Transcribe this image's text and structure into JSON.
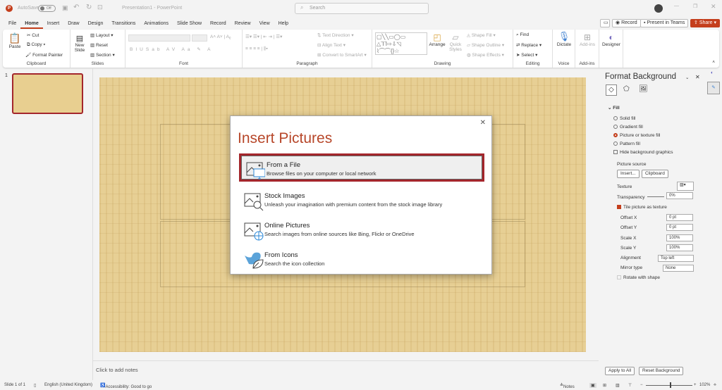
{
  "titlebar": {
    "autosave_label": "AutoSave",
    "autosave_state": "Off",
    "doc_title": "Presentation1 - PowerPoint",
    "search_placeholder": "Search"
  },
  "menu_tabs": [
    "File",
    "Home",
    "Insert",
    "Draw",
    "Design",
    "Transitions",
    "Animations",
    "Slide Show",
    "Record",
    "Review",
    "View",
    "Help"
  ],
  "active_tab": "Home",
  "top_buttons": {
    "record": "Record",
    "present_teams": "Present in Teams",
    "share": "Share"
  },
  "ribbon": {
    "clipboard": {
      "paste": "Paste",
      "cut": "Cut",
      "copy": "Copy",
      "format_painter": "Format Painter",
      "label": "Clipboard"
    },
    "slides": {
      "new_slide": "New Slide",
      "layout": "Layout",
      "reset": "Reset",
      "section": "Section",
      "label": "Slides"
    },
    "font": {
      "label": "Font",
      "bold": "B",
      "italic": "I",
      "underline": "U",
      "strike": "S"
    },
    "paragraph": {
      "text_direction": "Text Direction",
      "align_text": "Align Text",
      "convert_smartart": "Convert to SmartArt",
      "label": "Paragraph"
    },
    "drawing": {
      "arrange": "Arrange",
      "quick_styles": "Quick Styles",
      "shape_fill": "Shape Fill",
      "shape_outline": "Shape Outline",
      "shape_effects": "Shape Effects",
      "label": "Drawing"
    },
    "editing": {
      "find": "Find",
      "replace": "Replace",
      "select": "Select",
      "label": "Editing"
    },
    "voice": {
      "dictate": "Dictate",
      "label": "Voice"
    },
    "addins": {
      "addins": "Add-ins",
      "label": "Add-ins"
    },
    "designer": {
      "designer": "Designer"
    }
  },
  "thumbnail": {
    "number": "1"
  },
  "notes_placeholder": "Click to add notes",
  "dialog": {
    "title": "Insert Pictures",
    "options": [
      {
        "title": "From a File",
        "desc": "Browse files on your computer or local network",
        "icon": "picture-monitor-icon"
      },
      {
        "title": "Stock Images",
        "desc": "Unleash your imagination with premium content from the stock image library",
        "icon": "picture-search-icon"
      },
      {
        "title": "Online Pictures",
        "desc": "Search images from online sources like Bing, Flickr or OneDrive",
        "icon": "picture-globe-icon"
      },
      {
        "title": "From Icons",
        "desc": "Search the icon collection",
        "icon": "bird-leaf-icon"
      }
    ],
    "highlight_color": "#a4262c"
  },
  "format_pane": {
    "title": "Format Background",
    "section": "Fill",
    "fill_options": [
      "Solid fill",
      "Gradient fill",
      "Picture or texture fill",
      "Pattern fill"
    ],
    "selected_fill": "Picture or texture fill",
    "hide_bg_graphics": "Hide background graphics",
    "picture_source": "Picture source",
    "insert": "Insert...",
    "clipboard": "Clipboard",
    "texture": "Texture",
    "transparency_label": "Transparency",
    "transparency": "0%",
    "tile_label": "Tile picture as texture",
    "offset_x_label": "Offset X",
    "offset_x": "0 pt",
    "offset_y_label": "Offset Y",
    "offset_y": "0 pt",
    "scale_x_label": "Scale X",
    "scale_x": "100%",
    "scale_y_label": "Scale Y",
    "scale_y": "100%",
    "alignment_label": "Alignment",
    "alignment": "Top left",
    "mirror_label": "Mirror type",
    "mirror": "None",
    "rotate_label": "Rotate with shape",
    "apply_all": "Apply to All",
    "reset_bg": "Reset Background"
  },
  "status": {
    "slide": "Slide 1 of 1",
    "language": "English (United Kingdom)",
    "accessibility": "Accessibility: Good to go",
    "notes": "Notes",
    "zoom": "102%"
  },
  "colors": {
    "accent": "#c43e1c",
    "slide_bg": "#e7cf94"
  }
}
